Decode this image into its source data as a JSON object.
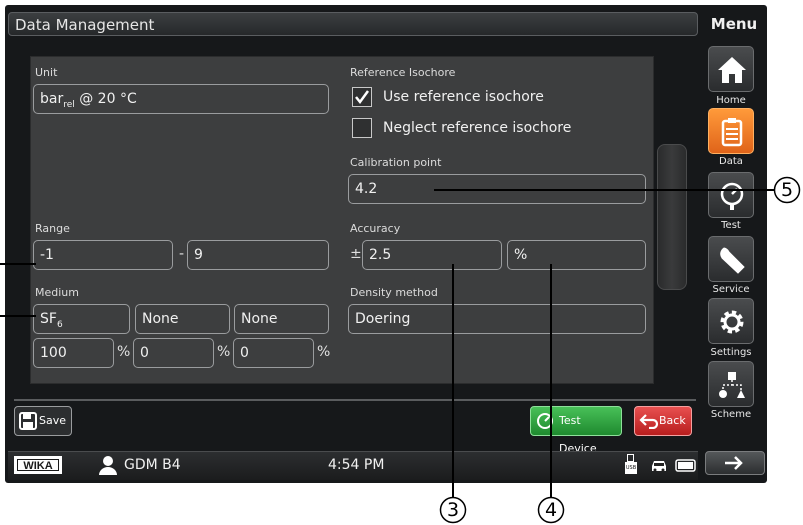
{
  "title": "Data Management",
  "menu": {
    "title": "Menu",
    "items": [
      {
        "label": "Home",
        "icon": "home-icon"
      },
      {
        "label": "Data",
        "icon": "clipboard-icon"
      },
      {
        "label": "Test",
        "icon": "gauge-icon"
      },
      {
        "label": "Service",
        "icon": "wrench-icon"
      },
      {
        "label": "Settings",
        "icon": "gear-icon"
      },
      {
        "label": "Scheme",
        "icon": "scheme-icon"
      }
    ]
  },
  "unit": {
    "label": "Unit",
    "base": "bar",
    "sub": "rel",
    "suffix": " @ 20 °C"
  },
  "reference_isochore": {
    "label": "Reference Isochore",
    "use_label": "Use reference isochore",
    "use_checked": true,
    "neglect_label": "Neglect reference isochore",
    "neglect_checked": false
  },
  "calibration_point": {
    "label": "Calibration point",
    "value": "4.2"
  },
  "range": {
    "label": "Range",
    "min": "-1",
    "separator": "-",
    "max": "9"
  },
  "accuracy": {
    "label": "Accuracy",
    "prefix": "±",
    "value": "2.5",
    "unit": "%"
  },
  "medium": {
    "label": "Medium",
    "gas1_base": "SF",
    "gas1_sub": "6",
    "gas2": "None",
    "gas3": "None",
    "pct1": "100",
    "pct2": "0",
    "pct3": "0",
    "pct_unit": "%"
  },
  "density_method": {
    "label": "Density method",
    "value": "Doering"
  },
  "buttons": {
    "save": "Save",
    "test_device": "Test Device",
    "back": "Back"
  },
  "status": {
    "brand": "WIKA",
    "device": "GDM B4",
    "time": "4:54 PM",
    "usb": "USB"
  },
  "callouts": {
    "three": "3",
    "four": "4",
    "five": "5"
  },
  "colors": {
    "accent_orange": "#f07a24",
    "test_green": "#2fa83f",
    "back_red": "#d42a2a"
  }
}
